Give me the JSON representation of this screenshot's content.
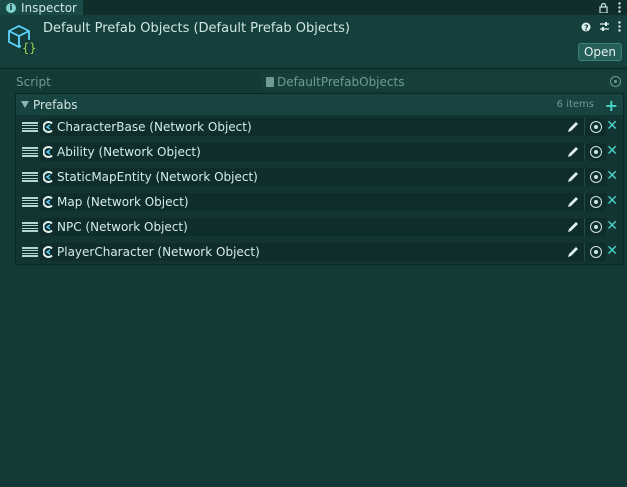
{
  "tabbar": {
    "tab_label": "Inspector",
    "lock_icon": "lock-icon",
    "menu_icon": "kebab-menu-icon"
  },
  "header": {
    "title": "Default Prefab Objects (Default Prefab Objects)",
    "icon": "scriptable-object-icon",
    "help_icon": "help-icon",
    "settings_icon": "preset-sliders-icon",
    "menu_icon": "kebab-menu-icon",
    "open_label": "Open"
  },
  "script": {
    "label": "Script",
    "value": "DefaultPrefabObjects"
  },
  "prefabs": {
    "label": "Prefabs",
    "count": "6 items",
    "items": [
      {
        "label": "CharacterBase (Network Object)"
      },
      {
        "label": "Ability (Network Object)"
      },
      {
        "label": "StaticMapEntity (Network Object)"
      },
      {
        "label": "Map (Network Object)"
      },
      {
        "label": "NPC (Network Object)"
      },
      {
        "label": "PlayerCharacter (Network Object)"
      }
    ]
  },
  "colors": {
    "background": "#143a38",
    "accent": "#49d6c9",
    "text": "#cfe6e2",
    "muted": "#6f9a95"
  }
}
